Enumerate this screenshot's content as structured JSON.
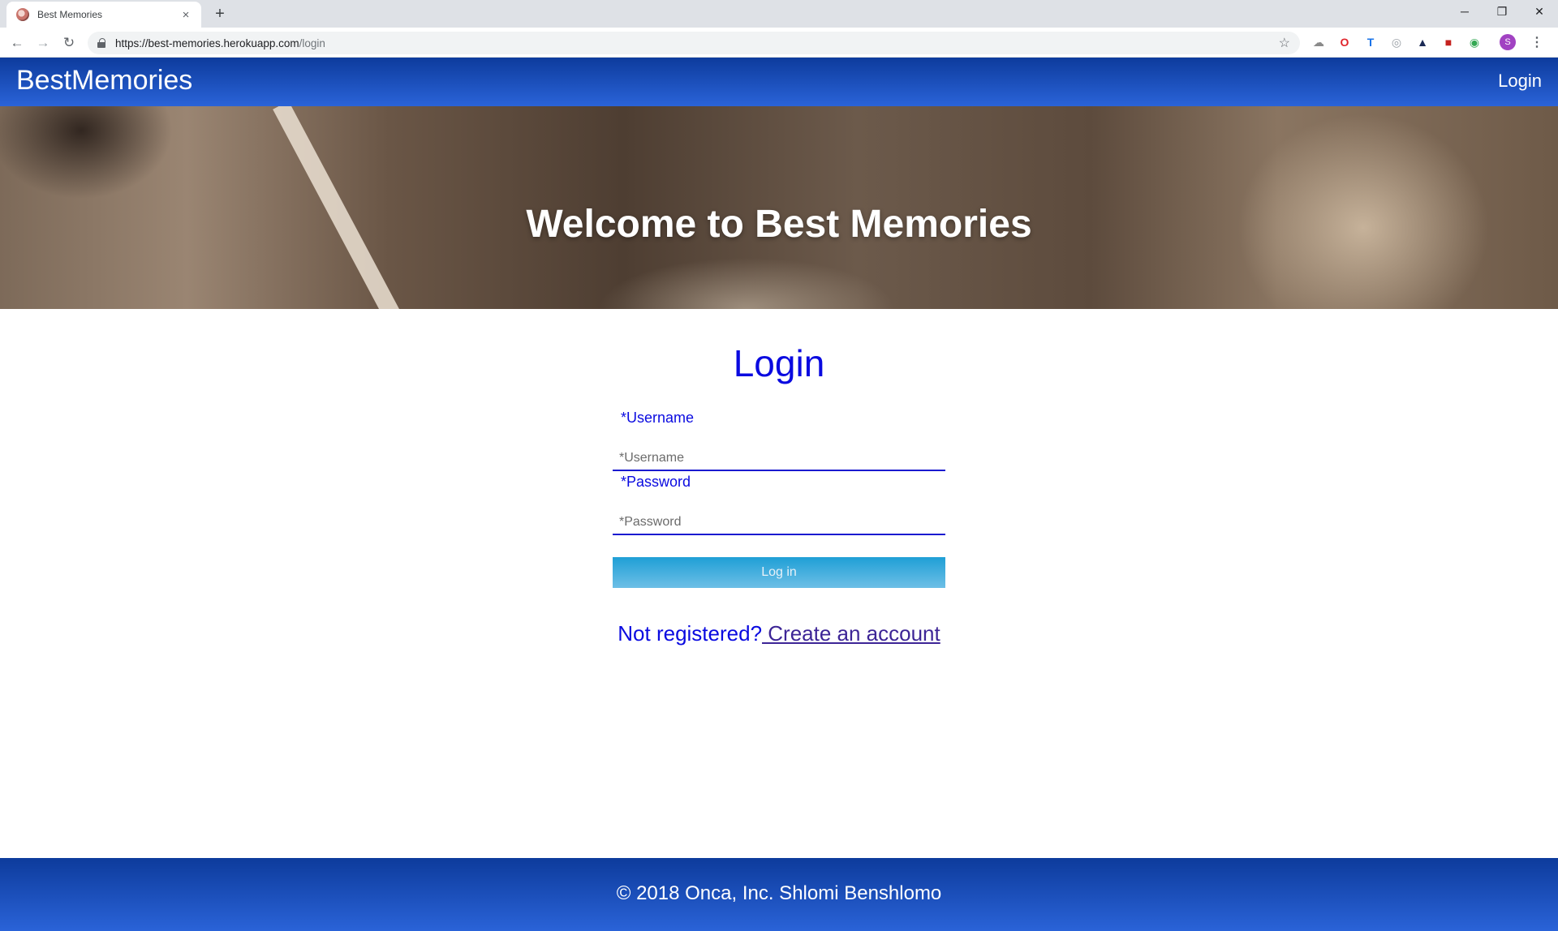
{
  "browser": {
    "tab_title": "Best Memories",
    "tab_close": "×",
    "new_tab": "+",
    "url_host": "https://best-memories.herokuapp.com",
    "url_path": "/login",
    "profile_initial": "S"
  },
  "site": {
    "brand": "BestMemories",
    "nav_login": "Login",
    "hero_title": "Welcome to Best Memories",
    "colors": {
      "navbar": "#1a4fc0",
      "heading": "#0a0ae0",
      "button": "#1f9fd6"
    }
  },
  "login": {
    "title": "Login",
    "username_label": "*Username",
    "username_placeholder": "*Username",
    "password_label": "*Password",
    "password_placeholder": "*Password",
    "submit_label": "Log in",
    "register_prompt": "Not registered?",
    "register_link": " Create an account"
  },
  "footer": {
    "text": "© 2018 Onca, Inc. Shlomi Benshlomo"
  }
}
